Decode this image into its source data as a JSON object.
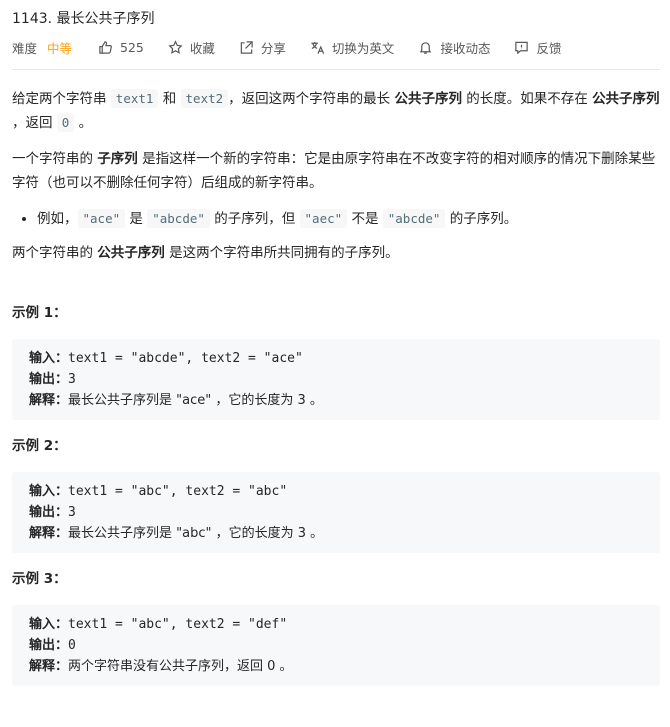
{
  "problem": {
    "title": "1143. 最长公共子序列",
    "difficulty_label": "难度",
    "difficulty_value": "中等",
    "likes": "525",
    "favorite_label": "收藏",
    "share_label": "分享",
    "translate_label": "切换为英文",
    "notify_label": "接收动态",
    "feedback_label": "反馈"
  },
  "colors": {
    "difficulty": "#ffa116",
    "code_bg": "#f7f7f7",
    "pre_bg": "#f7f8fa"
  },
  "description": {
    "p1_a": "给定两个字符串 ",
    "p1_code1": "text1",
    "p1_b": " 和 ",
    "p1_code2": "text2",
    "p1_c": "，返回这两个字符串的最长 ",
    "p1_bold1": "公共子序列",
    "p1_d": " 的长度。如果不存在 ",
    "p1_bold2": "公共子序列",
    "p1_e": " ，返回 ",
    "p1_code3": "0",
    "p1_f": " 。",
    "p2_a": "一个字符串的 ",
    "p2_bold": "子序列",
    "p2_b": " 是指这样一个新的字符串：它是由原字符串在不改变字符的相对顺序的情况下删除某些字符（也可以不删除任何字符）后组成的新字符串。",
    "li_a": "例如，",
    "li_code1": "\"ace\"",
    "li_b": " 是 ",
    "li_code2": "\"abcde\"",
    "li_c": " 的子序列，但 ",
    "li_code3": "\"aec\"",
    "li_d": " 不是 ",
    "li_code4": "\"abcde\"",
    "li_e": " 的子序列。",
    "p3_a": "两个字符串的 ",
    "p3_bold": "公共子序列",
    "p3_b": " 是这两个字符串所共同拥有的子序列。"
  },
  "examples": [
    {
      "title": "示例 1：",
      "input_label": "输入：",
      "input": "text1 = \"abcde\", text2 = \"ace\"",
      "output_label": "输出：",
      "output": "3",
      "explain_label": "解释：",
      "explain": "最长公共子序列是 \"ace\" ，它的长度为 3 。"
    },
    {
      "title": "示例 2：",
      "input_label": "输入：",
      "input": "text1 = \"abc\", text2 = \"abc\"",
      "output_label": "输出：",
      "output": "3",
      "explain_label": "解释：",
      "explain": "最长公共子序列是 \"abc\" ，它的长度为 3 。"
    },
    {
      "title": "示例 3：",
      "input_label": "输入：",
      "input": "text1 = \"abc\", text2 = \"def\"",
      "output_label": "输出：",
      "output": "0",
      "explain_label": "解释：",
      "explain": "两个字符串没有公共子序列，返回 0 。"
    }
  ]
}
